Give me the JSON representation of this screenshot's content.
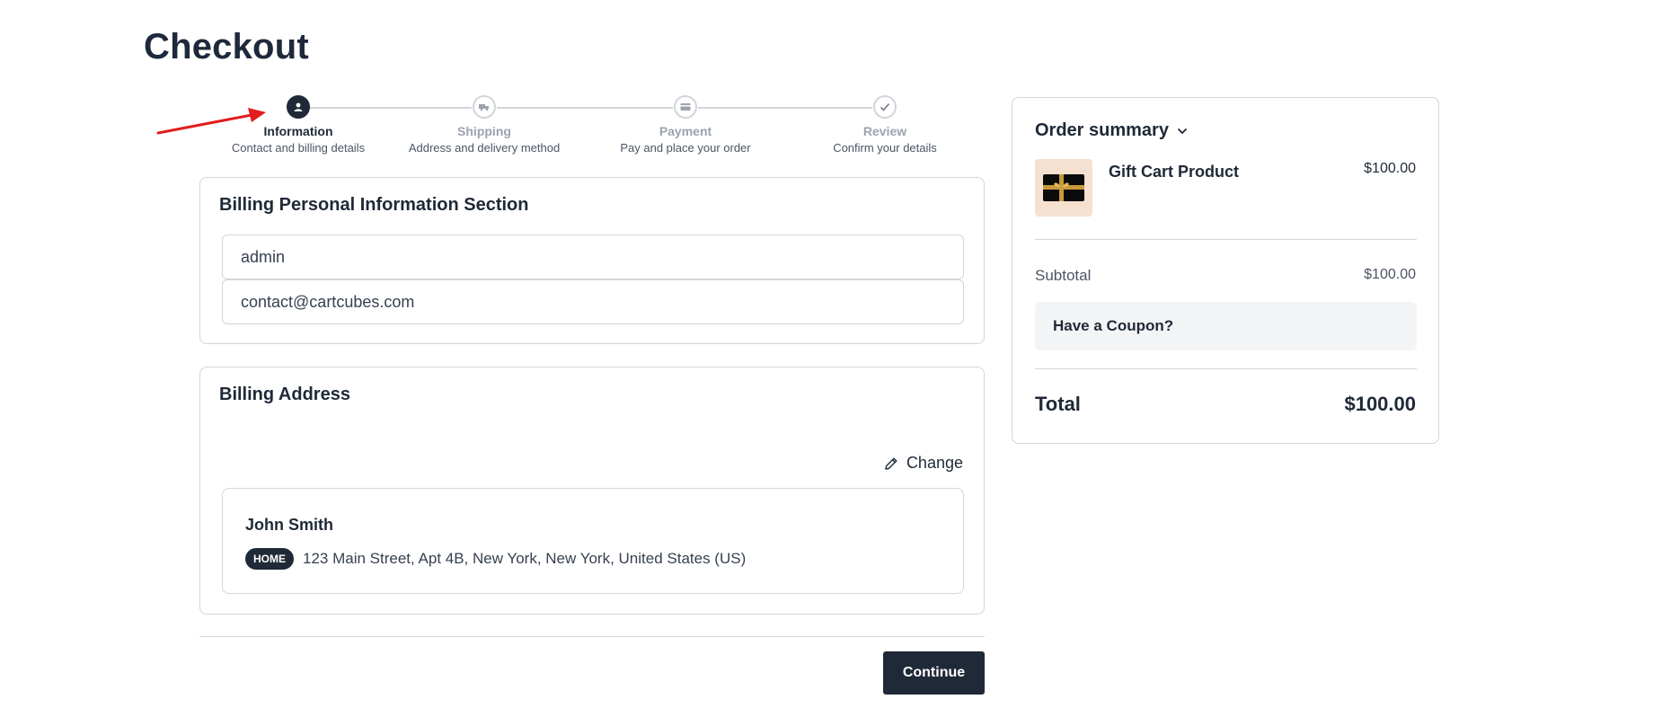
{
  "page": {
    "title": "Checkout"
  },
  "stepper": {
    "steps": [
      {
        "title": "Information",
        "subtitle": "Contact and billing details",
        "icon": "user-icon",
        "state": "active"
      },
      {
        "title": "Shipping",
        "subtitle": "Address and delivery method",
        "icon": "truck-icon",
        "state": "pending"
      },
      {
        "title": "Payment",
        "subtitle": "Pay and place your order",
        "icon": "card-icon",
        "state": "pending"
      },
      {
        "title": "Review",
        "subtitle": "Confirm your details",
        "icon": "check-icon",
        "state": "pending"
      }
    ]
  },
  "billing_info": {
    "title": "Billing Personal Information Section",
    "name_value": "admin",
    "email_value": "contact@cartcubes.com"
  },
  "billing_address": {
    "title": "Billing Address",
    "change_label": "Change",
    "name": "John Smith",
    "badge": "HOME",
    "address": "123 Main Street, Apt 4B, New York, New York, United States (US)"
  },
  "actions": {
    "continue_label": "Continue"
  },
  "summary": {
    "title": "Order summary",
    "product": {
      "name": "Gift Cart Product",
      "price": "$100.00",
      "image": "gift-card-image"
    },
    "subtotal_label": "Subtotal",
    "subtotal_value": "$100.00",
    "coupon_label": "Have a Coupon?",
    "total_label": "Total",
    "total_value": "$100.00"
  },
  "colors": {
    "primary": "#1f2937",
    "border": "#d1d5db",
    "annotation": "#e11d1d",
    "coupon_bg": "#f3f4f6",
    "product_bg": "#f6e0cf"
  }
}
